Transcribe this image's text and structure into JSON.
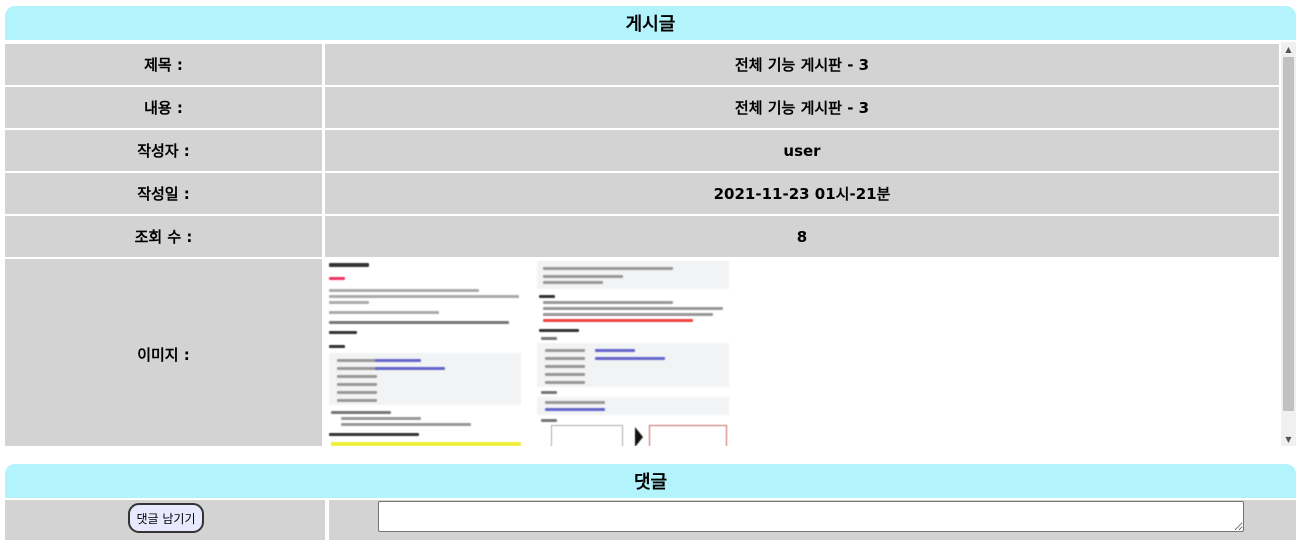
{
  "post": {
    "header": "게시글",
    "rows": [
      {
        "label": "제목 :",
        "value": "전체 기능 게시판 - 3"
      },
      {
        "label": "내용 :",
        "value": "전체 기능 게시판 - 3"
      },
      {
        "label": "작성자 :",
        "value": "user"
      },
      {
        "label": "작성일 :",
        "value": "2021-11-23 01시-21분"
      },
      {
        "label": "조회 수 :",
        "value": "8"
      },
      {
        "label": "이미지 :"
      }
    ]
  },
  "comments": {
    "header": "댓글",
    "submit_label": "댓글 남기기",
    "input_value": ""
  },
  "icons": {
    "scroll_up": "scroll-up-arrow-icon",
    "scroll_down": "scroll-down-arrow-icon"
  },
  "colors": {
    "header_bg": "#b3f3fb",
    "row_bg": "#d3d3d3",
    "button_bg": "#e8e8ff"
  }
}
